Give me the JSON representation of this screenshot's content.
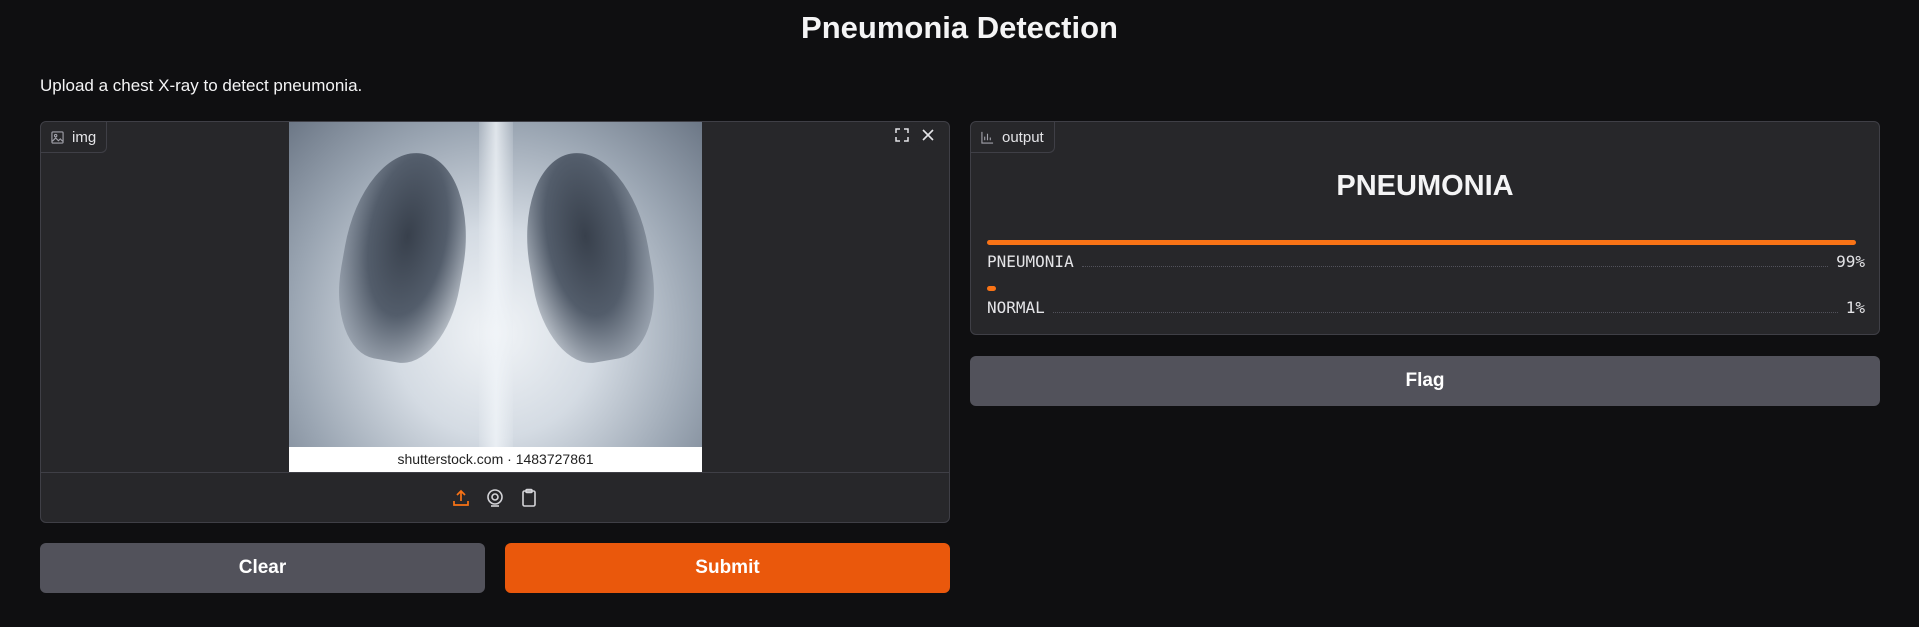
{
  "page": {
    "title": "Pneumonia Detection",
    "description": "Upload a chest X-ray to detect pneumonia."
  },
  "input": {
    "label": "img",
    "image_watermark": "shutterstock.com · 1483727861",
    "icons": [
      "image-icon",
      "fullscreen-icon",
      "close-icon",
      "upload-icon",
      "webcam-icon",
      "clipboard-icon"
    ]
  },
  "output": {
    "label": "output",
    "prediction": "PNEUMONIA",
    "confidences": [
      {
        "label": "PNEUMONIA",
        "percent_text": "99%",
        "fraction": 0.99
      },
      {
        "label": "NORMAL",
        "percent_text": "1%",
        "fraction": 0.01
      }
    ]
  },
  "buttons": {
    "clear": "Clear",
    "submit": "Submit",
    "flag": "Flag"
  },
  "colors": {
    "accent": "#ea580c",
    "bar": "#f97316",
    "secondary_button": "#52525b",
    "panel": "#27272a",
    "background": "#0f0f11"
  }
}
